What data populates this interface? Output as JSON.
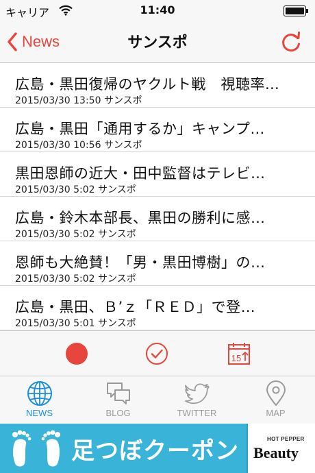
{
  "status_bar": {
    "carrier": "キャリア",
    "time": "11:40"
  },
  "nav": {
    "back_label": "News",
    "title": "サンスポ"
  },
  "news_items": [
    {
      "title": "広島・黒田復帰のヤクルト戦　視聴率…",
      "meta": "2015/03/30 13:50 サンスポ"
    },
    {
      "title": "広島・黒田「通用するか」キャンプ…",
      "meta": "2015/03/30 10:56 サンスポ"
    },
    {
      "title": "黒田恩師の近大・田中監督はテレビ…",
      "meta": "2015/03/30 5:02 サンスポ"
    },
    {
      "title": "広島・鈴木本部長、黒田の勝利に感…",
      "meta": "2015/03/30 5:02 サンスポ"
    },
    {
      "title": "恩師も大絶賛！「男・黒田博樹」の…",
      "meta": "2015/03/30 5:02 サンスポ"
    },
    {
      "title": "広島・黒田、Ｂ’ｚ「ＲＥＤ」で登…",
      "meta": "2015/03/30 5:01 サンスポ"
    }
  ],
  "toolbar": {
    "calendar_icon_text": "15"
  },
  "tabs": [
    {
      "label": "NEWS",
      "icon": "globe-icon",
      "active": true
    },
    {
      "label": "BLOG",
      "icon": "chat-bubbles-icon",
      "active": false
    },
    {
      "label": "TWITTER",
      "icon": "bird-icon",
      "active": false
    },
    {
      "label": "MAP",
      "icon": "map-pin-icon",
      "active": false
    }
  ],
  "ad": {
    "text": "足つぼクーポン",
    "logo_small": "HOT PEPPER",
    "logo_main": "Beauty"
  },
  "colors": {
    "accent": "#e8453c",
    "tab_active": "#1a8fe0",
    "tab_inactive": "#9a9a9a",
    "ad_background": "#3ab3d8"
  }
}
